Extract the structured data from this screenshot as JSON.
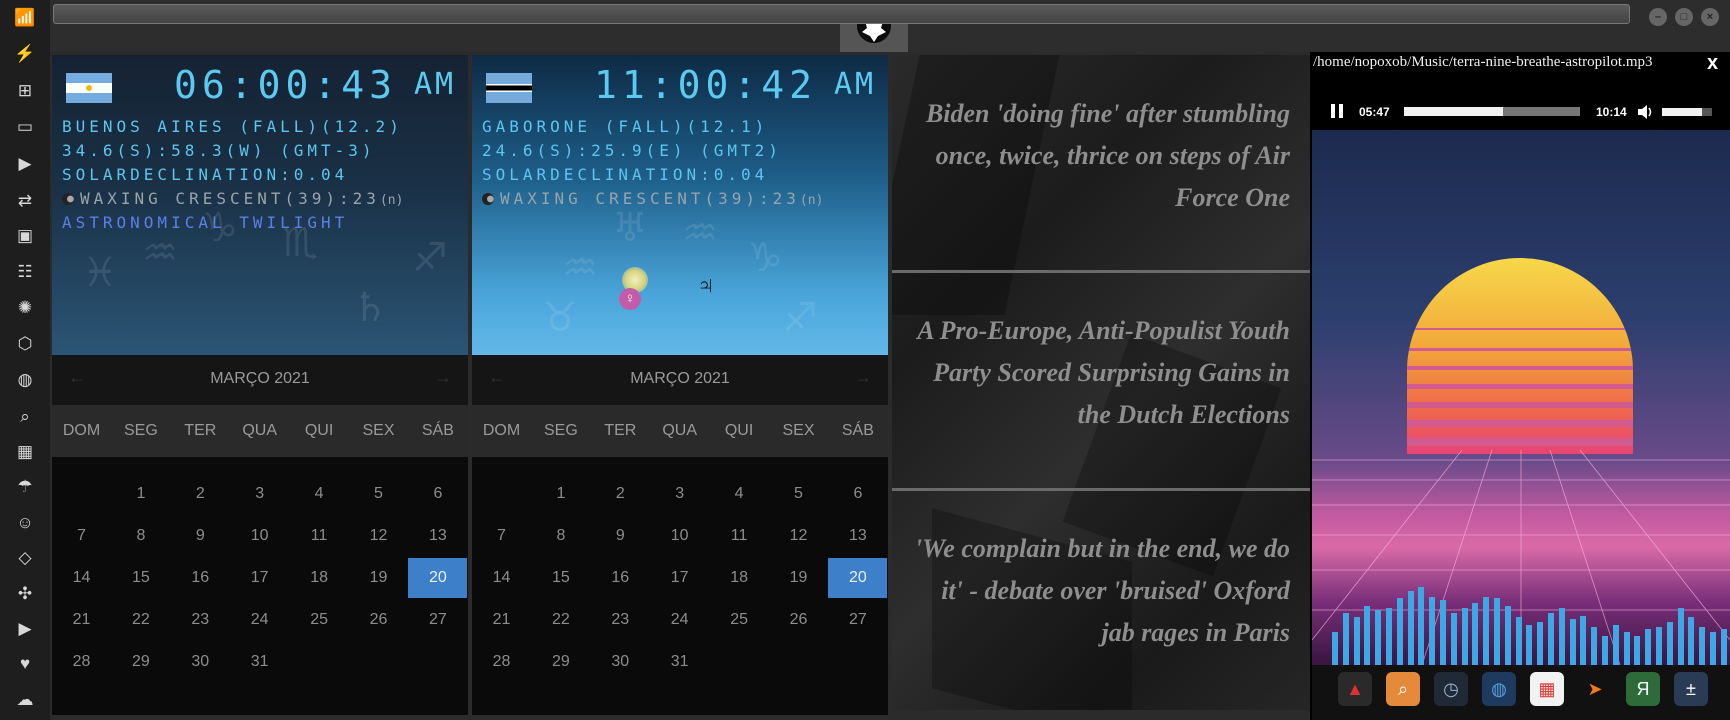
{
  "colors": {
    "accent": "#3d7fc8",
    "clock_digits": "#5ccaf0",
    "twilight": "#5a80e8"
  },
  "dock": {
    "icons": [
      "wifi-icon",
      "bolt-icon",
      "windows-icon",
      "inbox-icon",
      "play-icon",
      "translate-icon",
      "image-icon",
      "news-icon",
      "rebel-icon",
      "hexagon-icon",
      "globe-icon",
      "search-icon",
      "map-icon",
      "umbrella-icon",
      "contacts-icon",
      "tag-icon",
      "expand-icon",
      "youtube-icon",
      "heart-icon",
      "cloud-icon"
    ]
  },
  "clocks": [
    {
      "time": "06:00:43",
      "ampm": "AM",
      "line1": "BUENOS AIRES (FALL)(12.2)",
      "line2": "34.6(S):58.3(W) (GMT-3)",
      "line3": "SOLARDECLINATION:0.04",
      "moon": "WAXING CRESCENT(39):23",
      "moon_suffix": "(n)",
      "twilight": "ASTRONOMICAL TWILIGHT"
    },
    {
      "time": "11:00:42",
      "ampm": "AM",
      "line1": "GABORONE (FALL)(12.1)",
      "line2": "24.6(S):25.9(E) (GMT2)",
      "line3": "SOLARDECLINATION:0.04",
      "moon": "WAXING CRESCENT(39):23",
      "moon_suffix": "(n)",
      "planets": [
        "♀",
        "♃"
      ]
    }
  ],
  "calendar": {
    "title": "MARÇO 2021",
    "prev": "←",
    "next": "→",
    "weekdays": [
      "DOM",
      "SEG",
      "TER",
      "QUA",
      "QUI",
      "SEX",
      "SÁB"
    ],
    "weeks": [
      [
        "",
        "1",
        "2",
        "3",
        "4",
        "5",
        "6"
      ],
      [
        "7",
        "8",
        "9",
        "10",
        "11",
        "12",
        "13"
      ],
      [
        "14",
        "15",
        "16",
        "17",
        "18",
        "19",
        "20"
      ],
      [
        "21",
        "22",
        "23",
        "24",
        "25",
        "26",
        "27"
      ],
      [
        "28",
        "29",
        "30",
        "31",
        "",
        "",
        ""
      ]
    ],
    "selected": "20"
  },
  "news": [
    "Biden 'doing fine' after stumbling once, twice, thrice on steps of Air Force One",
    "A Pro-Europe, Anti-Populist Youth Party Scored Surprising Gains in the Dutch Elections",
    "'We complain but in the end, we do it' - debate over 'bruised' Oxford jab rages in Paris"
  ],
  "player": {
    "path": "/home/nopoxob/Music/terra-nine-breathe-astropilot.mp3",
    "close": "x",
    "elapsed": "05:47",
    "duration": "10:14",
    "progress": 0.565,
    "volume": 0.8,
    "spectrum": [
      0.35,
      0.55,
      0.5,
      0.62,
      0.58,
      0.6,
      0.7,
      0.78,
      0.82,
      0.72,
      0.68,
      0.55,
      0.6,
      0.65,
      0.72,
      0.7,
      0.62,
      0.5,
      0.42,
      0.45,
      0.55,
      0.6,
      0.48,
      0.52,
      0.4,
      0.3,
      0.42,
      0.35,
      0.3,
      0.38,
      0.4,
      0.45,
      0.6,
      0.5,
      0.4,
      0.35,
      0.38
    ]
  },
  "tray": [
    "app-launcher-icon",
    "search-icon",
    "clock-icon",
    "globe-icon",
    "calendar-icon",
    "arrow-icon",
    "yandex-icon",
    "calculator-icon"
  ]
}
